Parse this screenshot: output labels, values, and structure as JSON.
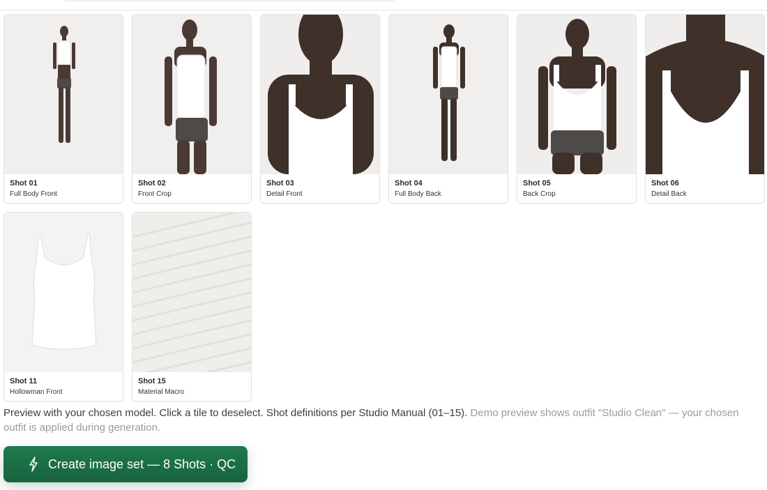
{
  "shots": [
    {
      "number": "Shot 01",
      "name": "Full Body Front"
    },
    {
      "number": "Shot 02",
      "name": "Front Crop"
    },
    {
      "number": "Shot 03",
      "name": "Detail Front"
    },
    {
      "number": "Shot 04",
      "name": "Full Body Back"
    },
    {
      "number": "Shot 05",
      "name": "Back Crop"
    },
    {
      "number": "Shot 06",
      "name": "Detail Back"
    },
    {
      "number": "Shot 11",
      "name": "Hollowman Front"
    },
    {
      "number": "Shot 15",
      "name": "Material Macro"
    }
  ],
  "note": {
    "main": "Preview with your chosen model. Click a tile to deselect. Shot definitions per Studio Manual (01–15).",
    "muted": "Demo preview shows outfit \"Studio Clean\" — your chosen outfit is applied during generation."
  },
  "cta": {
    "label": "Create image set — 8 Shots · QC",
    "icon": "lightning-bolt-icon"
  }
}
